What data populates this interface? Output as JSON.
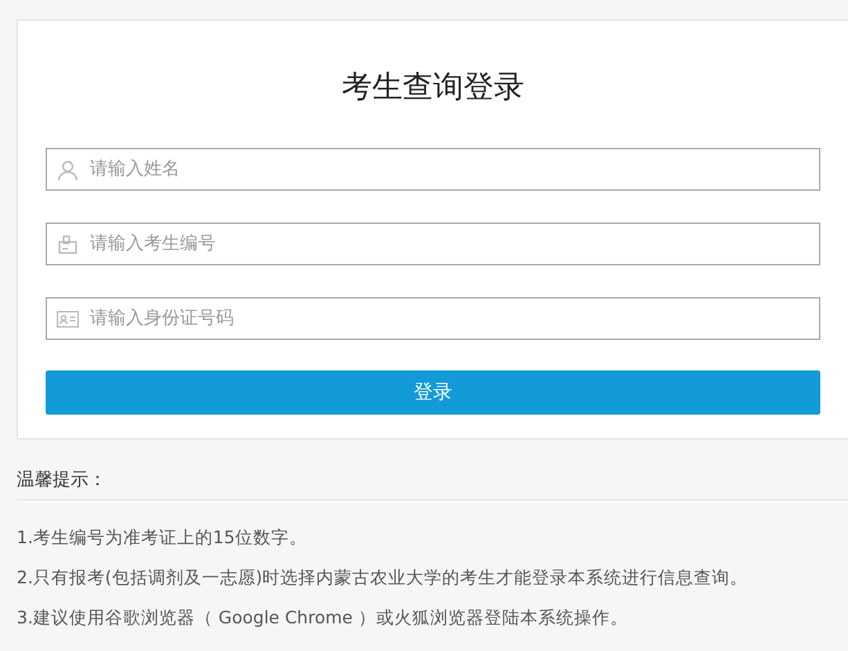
{
  "login": {
    "title": "考生查询登录",
    "fields": [
      {
        "kind": "person",
        "placeholder": "请输入姓名"
      },
      {
        "kind": "badge",
        "placeholder": "请输入考生编号"
      },
      {
        "kind": "card",
        "placeholder": "请输入身份证号码"
      }
    ],
    "button": "登录"
  },
  "tips": {
    "heading": "温馨提示：",
    "items": [
      "1.考生编号为准考证上的15位数字。",
      "2.只有报考(包括调剂及一志愿)时选择内蒙古农业大学的考生才能登录本系统进行信息查询。",
      "3.建议使用谷歌浏览器（ Google Chrome ）或火狐浏览器登陆本系统操作。"
    ]
  }
}
